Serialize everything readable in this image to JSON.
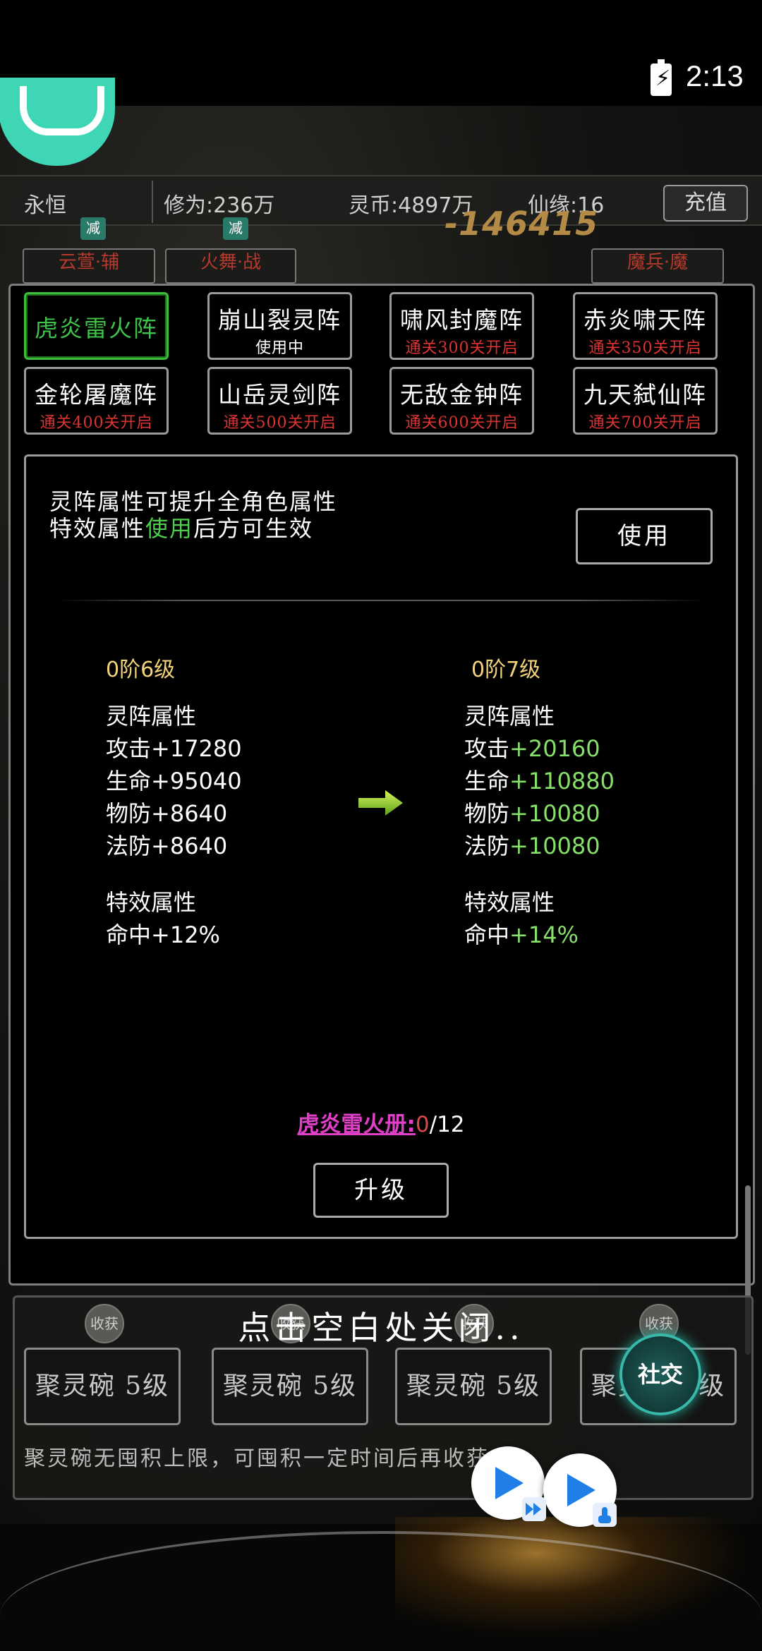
{
  "status_bar": {
    "time": "2:13",
    "battery_icon": "battery-charging-icon"
  },
  "top_bar": {
    "title": "永恒",
    "cultivation": "修为:236万",
    "spirit_coins": "灵币:4897万",
    "fate": "仙缘:16",
    "recharge_label": "充值",
    "damage_number": "-146415"
  },
  "team": {
    "tag_label": "减",
    "units": [
      {
        "label": "云萱·辅"
      },
      {
        "label": "火舞·战"
      },
      {
        "label": "魔兵·魔"
      }
    ]
  },
  "formations": [
    {
      "name": "虎炎雷火阵",
      "sub": ""
    },
    {
      "name": "崩山裂灵阵",
      "sub": "使用中"
    },
    {
      "name": "啸风封魔阵",
      "sub": "通关300关开启"
    },
    {
      "name": "赤炎啸天阵",
      "sub": "通关350关开启"
    },
    {
      "name": "金轮屠魔阵",
      "sub": "通关400关开启"
    },
    {
      "name": "山岳灵剑阵",
      "sub": "通关500关开启"
    },
    {
      "name": "无敌金钟阵",
      "sub": "通关600关开启"
    },
    {
      "name": "九天弑仙阵",
      "sub": "通关700关开启"
    }
  ],
  "detail": {
    "desc_line1": "灵阵属性可提升全角色属性",
    "desc_line2_a": "特效属性",
    "desc_line2_b": "使用",
    "desc_line2_c": "后方可生效",
    "use_label": "使用",
    "current": {
      "level": "0阶6级",
      "attr_header": "灵阵属性",
      "attrs": [
        {
          "name": "攻击",
          "value": "+17280"
        },
        {
          "name": "生命",
          "value": "+95040"
        },
        {
          "name": "物防",
          "value": "+8640"
        },
        {
          "name": "法防",
          "value": "+8640"
        }
      ],
      "effect_header": "特效属性",
      "effect": {
        "name": "命中",
        "value": "+12%"
      }
    },
    "next": {
      "level": "0阶7级",
      "attr_header": "灵阵属性",
      "attrs": [
        {
          "name": "攻击",
          "value": "+20160"
        },
        {
          "name": "生命",
          "value": "+110880"
        },
        {
          "name": "物防",
          "value": "+10080"
        },
        {
          "name": "法防",
          "value": "+10080"
        }
      ],
      "effect_header": "特效属性",
      "effect": {
        "name": "命中",
        "value": "+14%"
      }
    },
    "book_name": "虎炎雷火册:",
    "book_have": "0",
    "book_need": "/12",
    "upgrade_label": "升级"
  },
  "lower": {
    "close_hint": "点击空白处关闭..",
    "harvest_label": "收获",
    "bowls": [
      "聚灵碗 5级",
      "聚灵碗 5级",
      "聚灵碗 5级",
      "聚灵碗 5级"
    ],
    "note": "聚灵碗无囤积上限，可囤积一定时间后再收获",
    "social_label": "社交"
  },
  "colors": {
    "accent_green": "#3ec24a",
    "lock_red": "#d33333",
    "level_gold": "#f2d27a",
    "book_magenta": "#e040c8"
  }
}
